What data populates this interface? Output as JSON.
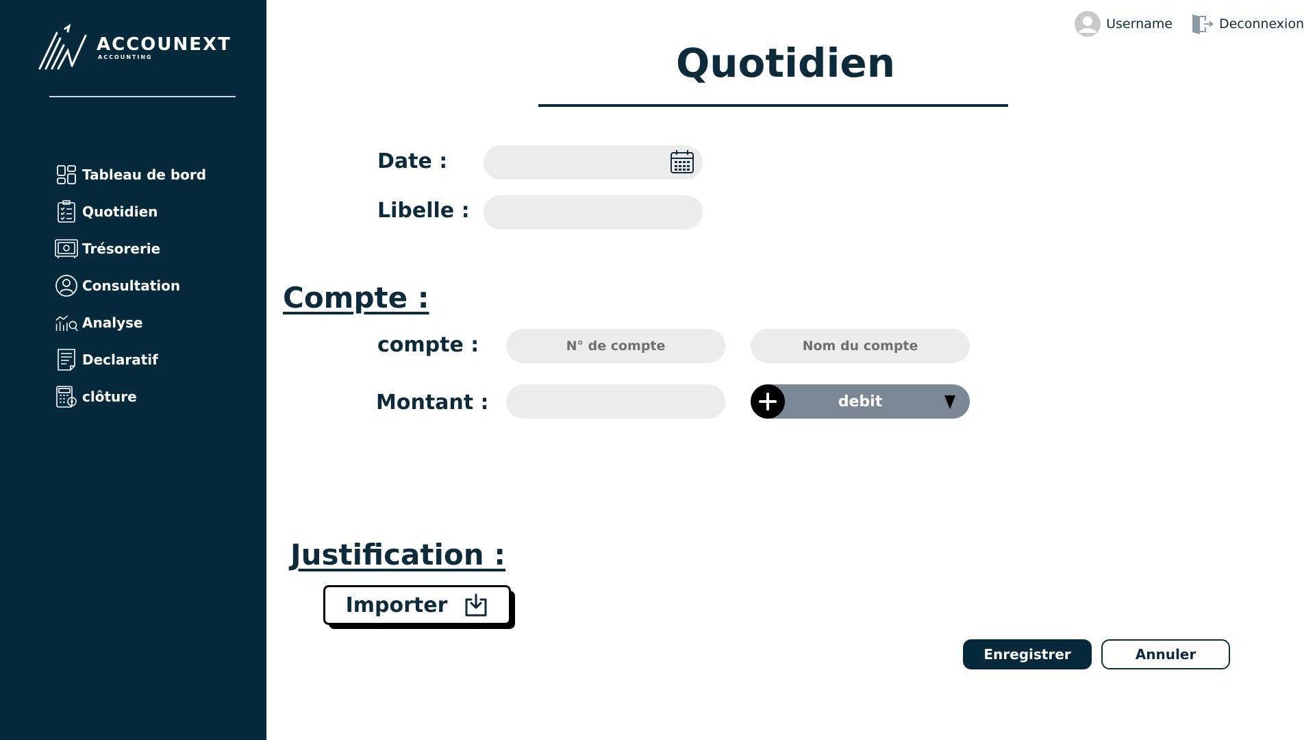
{
  "brand": {
    "name": "ACCOUNEXT",
    "tagline": "ACCOUNTING"
  },
  "sidebar": {
    "items": [
      {
        "label": "Tableau de bord",
        "icon": "dashboard-icon"
      },
      {
        "label": "Quotidien",
        "icon": "clipboard-checklist-icon"
      },
      {
        "label": "Trésorerie",
        "icon": "safe-icon"
      },
      {
        "label": "Consultation",
        "icon": "consultant-icon"
      },
      {
        "label": "Analyse",
        "icon": "analysis-chart-icon"
      },
      {
        "label": "Declaratif",
        "icon": "document-form-icon"
      },
      {
        "label": "clôture",
        "icon": "calculator-icon"
      }
    ]
  },
  "header": {
    "username": "Username",
    "logout": "Deconnexion"
  },
  "page": {
    "title": "Quotidien"
  },
  "form": {
    "date_label": "Date :",
    "date_value": "",
    "libelle_label": "Libelle :",
    "libelle_value": ""
  },
  "compte": {
    "section_title": "Compte  :",
    "compte_label": "compte :",
    "numero_placeholder": "N° de compte",
    "nom_placeholder": "Nom du compte",
    "montant_label": "Montant :",
    "montant_value": "",
    "type_selected": "debit"
  },
  "justification": {
    "section_title": "Justification  :",
    "import_label": "Importer"
  },
  "actions": {
    "save_label": "Enregistrer",
    "cancel_label": "Annuler"
  },
  "colors": {
    "sidebar": "#062a3b",
    "text": "#0d2b3a",
    "field": "#ececec",
    "select": "#7a8794"
  }
}
